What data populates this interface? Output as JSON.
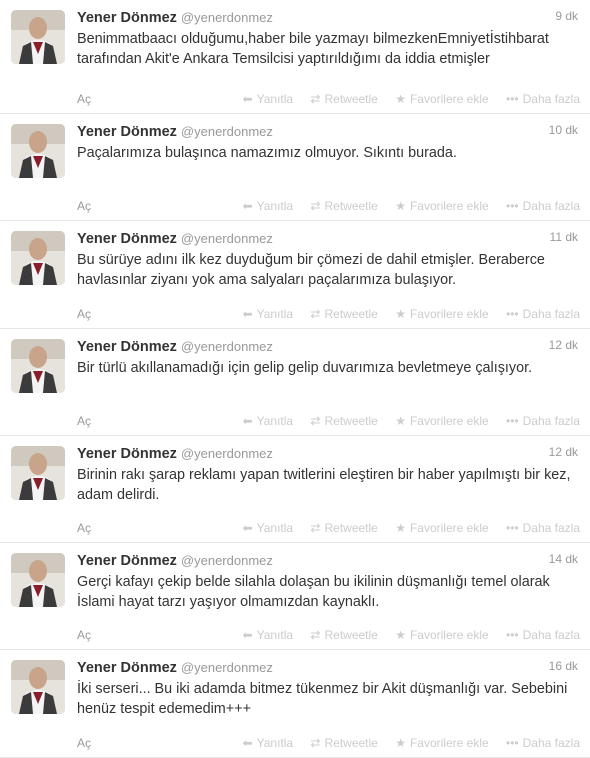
{
  "labels": {
    "expand": "Aç",
    "reply": "Yanıtla",
    "retweet": "Retweetle",
    "favorite": "Favorilere ekle",
    "more": "Daha fazla"
  },
  "tweets": [
    {
      "name": "Yener Dönmez",
      "handle": "@yenerdonmez",
      "time": "9 dk",
      "text": "Benimmatbaacı olduğumu,haber bile yazmayı bilmezkenEmniyetİstihbarat tarafından Akit'e Ankara Temsilcisi yaptırıldığımı da iddia etmişler"
    },
    {
      "name": "Yener Dönmez",
      "handle": "@yenerdonmez",
      "time": "10 dk",
      "text": "Paçalarımıza bulaşınca namazımız olmuyor. Sıkıntı burada."
    },
    {
      "name": "Yener Dönmez",
      "handle": "@yenerdonmez",
      "time": "11 dk",
      "text": "Bu sürüye adını ilk kez duyduğum bir çömezi de dahil etmişler. Beraberce havlasınlar ziyanı yok ama salyaları paçalarımıza bulaşıyor."
    },
    {
      "name": "Yener Dönmez",
      "handle": "@yenerdonmez",
      "time": "12 dk",
      "text": "Bir türlü akıllanamadığı için gelip gelip duvarımıza bevletmeye çalışıyor."
    },
    {
      "name": "Yener Dönmez",
      "handle": "@yenerdonmez",
      "time": "12 dk",
      "text": "Birinin rakı şarap reklamı yapan twitlerini eleştiren bir haber yapılmıştı bir kez, adam delirdi."
    },
    {
      "name": "Yener Dönmez",
      "handle": "@yenerdonmez",
      "time": "14 dk",
      "text": "Gerçi kafayı çekip belde silahla dolaşan bu ikilinin düşmanlığı temel olarak İslami hayat tarzı yaşıyor olmamızdan kaynaklı."
    },
    {
      "name": "Yener Dönmez",
      "handle": "@yenerdonmez",
      "time": "16 dk",
      "text": "İki serseri... Bu iki adamda bitmez tükenmez bir Akit düşmanlığı var. Sebebini henüz tespit edemedim+++"
    }
  ]
}
